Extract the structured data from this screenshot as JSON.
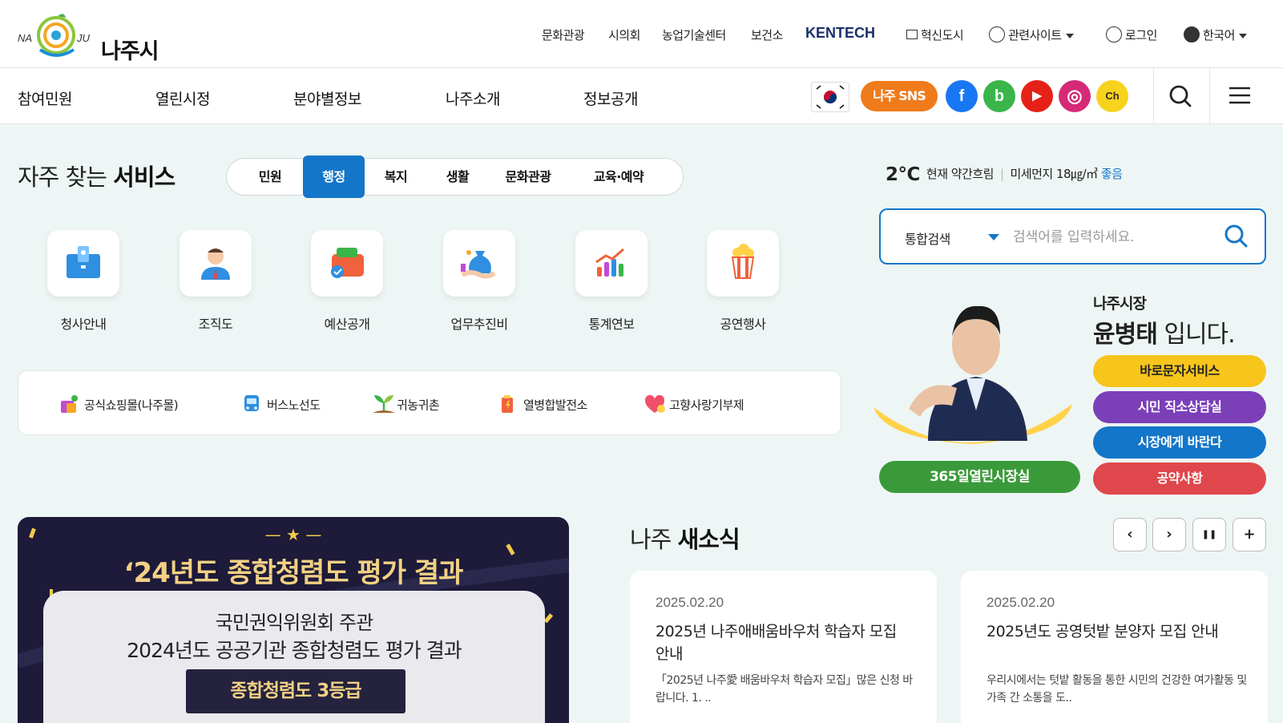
{
  "header": {
    "logo_text": "나주시",
    "logo_letters": "NA JU",
    "util_links": [
      "문화관광",
      "시의회",
      "농업기술센터",
      "보건소"
    ],
    "kentech": "KENTECH",
    "innovation_city": "혁신도시",
    "related_sites": "관련사이트",
    "login": "로그인",
    "language": "한국어"
  },
  "nav": {
    "items": [
      "참여민원",
      "열린시정",
      "분야별정보",
      "나주소개",
      "정보공개"
    ],
    "sns_label": "나주 SNS",
    "sns": [
      {
        "icon": "facebook-icon",
        "glyph": "f",
        "color": "#1877f2"
      },
      {
        "icon": "blog-icon",
        "glyph": "b",
        "color": "#3ab54a"
      },
      {
        "icon": "youtube-icon",
        "glyph": "▶",
        "color": "#e62117"
      },
      {
        "icon": "instagram-icon",
        "glyph": "◎",
        "color": "#d62976"
      },
      {
        "icon": "kakao-channel-icon",
        "glyph": "Ch",
        "color": "#f7d31e"
      }
    ]
  },
  "services": {
    "title_light": "자주 찾는",
    "title_bold": "서비스",
    "tabs": [
      "민원",
      "행정",
      "복지",
      "생활",
      "문화관광",
      "교육·예약"
    ],
    "active_tab": 1,
    "items": [
      {
        "label": "청사안내",
        "icon": "building-icon"
      },
      {
        "label": "조직도",
        "icon": "person-icon"
      },
      {
        "label": "예산공개",
        "icon": "wallet-icon"
      },
      {
        "label": "업무추진비",
        "icon": "money-bag-icon"
      },
      {
        "label": "통계연보",
        "icon": "chart-icon"
      },
      {
        "label": "공연행사",
        "icon": "popcorn-icon"
      }
    ],
    "quick": [
      {
        "label": "공식쇼핑몰(나주몰)",
        "icon": "shopping-bag-icon"
      },
      {
        "label": "버스노선도",
        "icon": "bus-icon"
      },
      {
        "label": "귀농귀촌",
        "icon": "sprout-icon"
      },
      {
        "label": "열병합발전소",
        "icon": "power-plant-icon"
      },
      {
        "label": "고향사랑기부제",
        "icon": "heart-icon"
      }
    ]
  },
  "weather": {
    "temp": "2°C",
    "status": "현재 약간흐림",
    "dust": "미세먼지 18㎍/㎥",
    "dust_grade": "좋음"
  },
  "search": {
    "scope": "통합검색",
    "placeholder": "검색어를 입력하세요."
  },
  "mayor": {
    "line1": "나주시장",
    "name": "윤병태",
    "suffix": "입니다.",
    "buttons": [
      {
        "label": "바로문자서비스",
        "color": "#f7c51c",
        "text": "#222222"
      },
      {
        "label": "시민 직소상담실",
        "color": "#7b3fb8",
        "text": "#ffffff"
      },
      {
        "label": "시장에게 바란다",
        "color": "#1476c8",
        "text": "#ffffff"
      },
      {
        "label": "공약사항",
        "color": "#e0474c",
        "text": "#ffffff"
      }
    ],
    "open_office": "365일열린시장실"
  },
  "banner": {
    "title": "‘24년도 종합청렴도 평가 결과",
    "sub1": "국민권익위원회 주관",
    "sub2": "2024년도 공공기관 종합청렴도 평가 결과",
    "grade": "종합청렴도 3등급"
  },
  "news": {
    "title_light": "나주",
    "title_bold": "새소식",
    "controls": [
      "‹",
      "›",
      "❚❚",
      "+"
    ],
    "items": [
      {
        "date": "2025.02.20",
        "title": "2025년 나주애배움바우처 학습자 모집 안내",
        "desc": "「2025년 나주愛 배움바우처 학습자 모집」많은 신청 바랍니다. 1. .."
      },
      {
        "date": "2025.02.20",
        "title": "2025년도 공영텃밭 분양자 모집 안내",
        "desc": "우리시에서는 텃밭 활동을 통한 시민의 건강한 여가활동 및 가족 간 소통을 도.."
      }
    ]
  },
  "colors": {
    "accent": "#1476c8",
    "sns_orange": "#f07b1b",
    "background": "#eef6f5"
  }
}
